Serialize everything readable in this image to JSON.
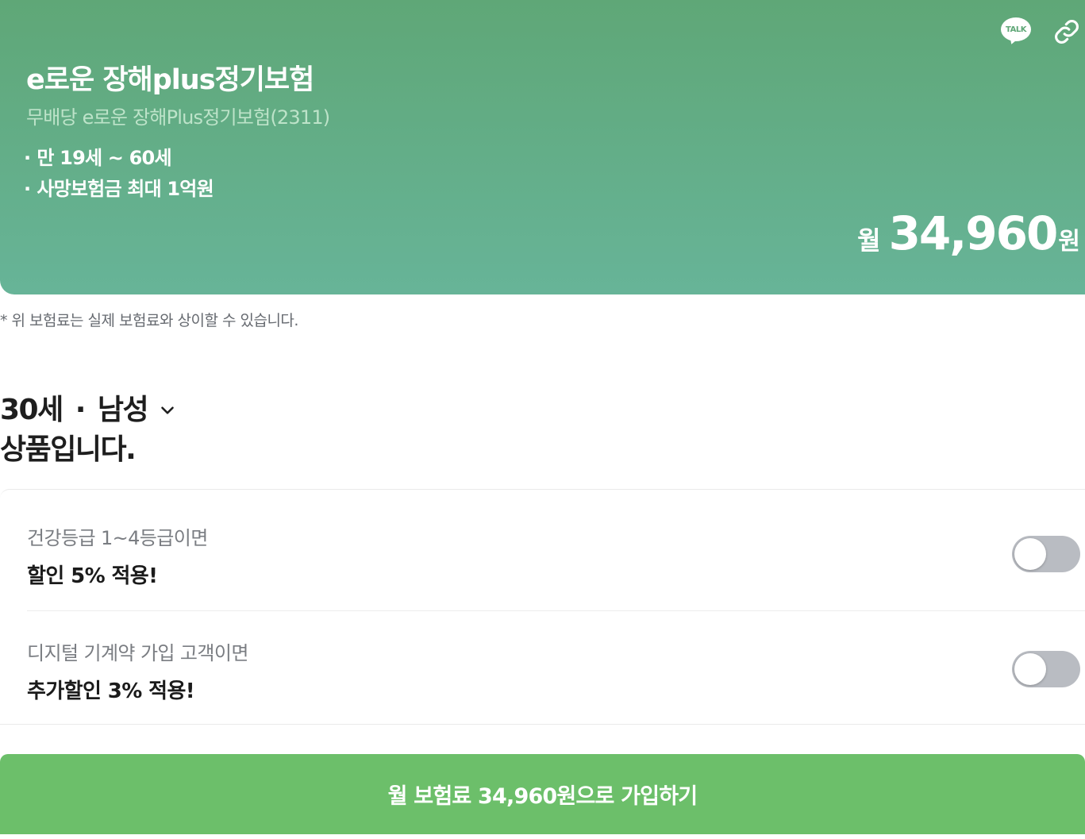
{
  "hero": {
    "title": "e로운 장해plus정기보험",
    "subtitle": "무배당 e로운 장해Plus정기보험(2311)",
    "bullets": [
      "만 19세 ~ 60세",
      "사망보험금 최대 1억원"
    ],
    "price_prefix": "월",
    "price_amount": "34,960",
    "price_unit": "원",
    "talk_label": "TALK",
    "bg_color_top": "#5fa777",
    "bg_color_bottom": "#67b498"
  },
  "note": "* 위 보험료는 실제 보험료와 상이할 수 있습니다.",
  "profile": {
    "age": "30세",
    "separator": "·",
    "gender": "남성",
    "suffix": "상품입니다."
  },
  "discounts": [
    {
      "caption": "건강등급 1~4등급이면",
      "title": "할인 5% 적용!",
      "enabled": false
    },
    {
      "caption": "디지털 기계약 가입 고객이면",
      "title": "추가할인 3% 적용!",
      "enabled": false
    }
  ],
  "cta": {
    "label": "월 보험료 34,960원으로 가입하기",
    "color": "#6cbf6a"
  }
}
